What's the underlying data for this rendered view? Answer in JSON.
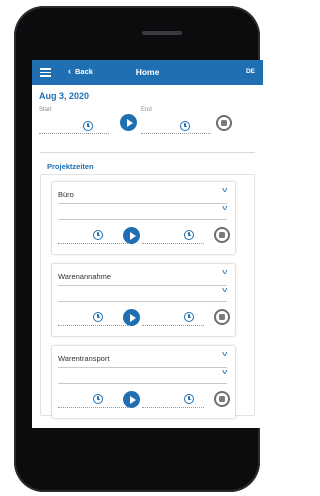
{
  "header": {
    "back_label": "Back",
    "title": "Home",
    "language": "DE"
  },
  "today": {
    "date": "Aug 3, 2020",
    "start_label": "Start",
    "end_label": "End"
  },
  "projects_section": {
    "title": "Projektzeiten",
    "items": [
      {
        "name": "Büro"
      },
      {
        "name": "Warenannahme"
      },
      {
        "name": "Warentransport"
      }
    ]
  },
  "colors": {
    "accent": "#1f6fb2",
    "stop_gray": "#6f6f6f",
    "device": "#0c0c0e"
  },
  "icons": {
    "menu": "hamburger-menu-icon",
    "back": "chevron-left-icon",
    "time": "clock-icon",
    "start": "play-icon",
    "stop": "stop-icon",
    "dropdown": "chevron-down-icon"
  }
}
